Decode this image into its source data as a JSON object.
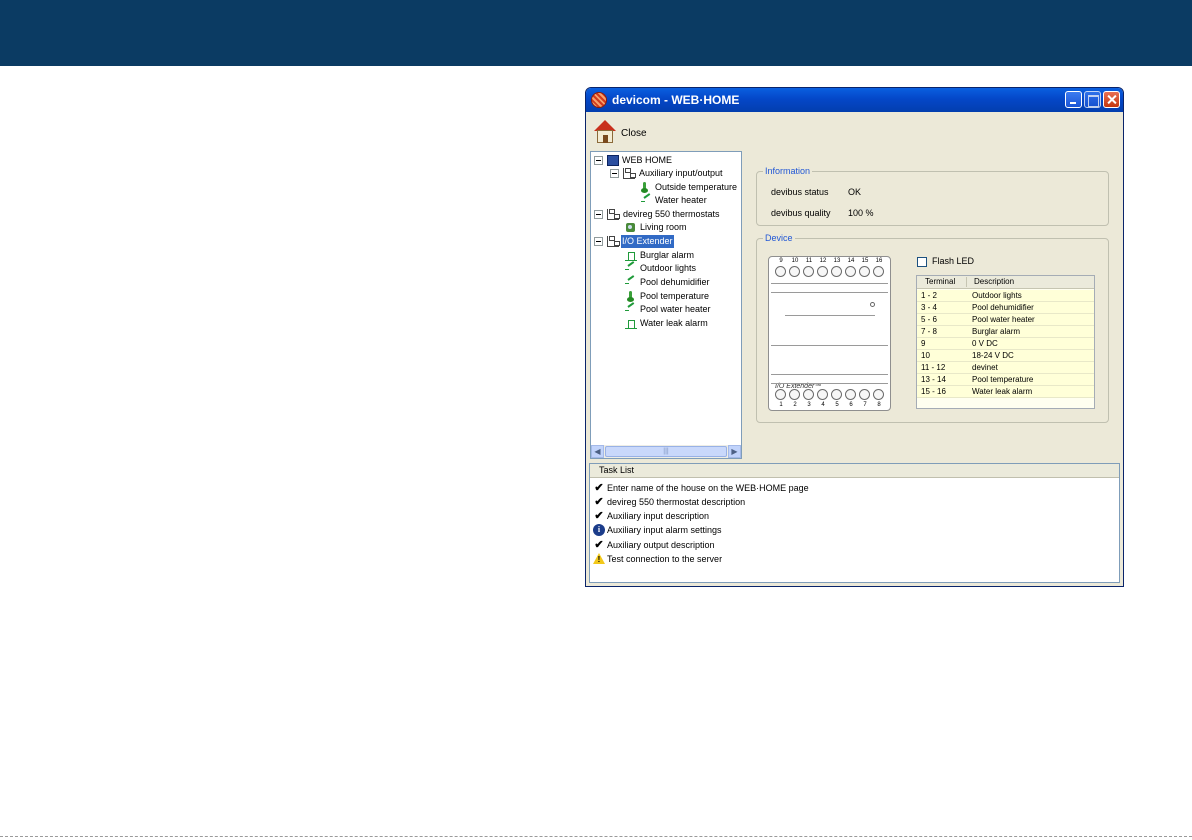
{
  "window": {
    "title": "devicom - WEB·HOME"
  },
  "toolbar": {
    "close_label": "Close"
  },
  "tree": {
    "root": "WEB HOME",
    "aux_group": "Auxiliary input/output",
    "aux_items": [
      "Outside temperature",
      "Water heater"
    ],
    "thermostats_group": "devireg 550 thermostats",
    "thermostat_items": [
      "Living room"
    ],
    "extender_group": "I/O Extender",
    "extender_items": [
      "Burglar alarm",
      "Outdoor lights",
      "Pool dehumidifier",
      "Pool temperature",
      "Pool water heater",
      "Water leak alarm"
    ]
  },
  "information": {
    "legend": "Information",
    "status_label": "devibus status",
    "status_value": "OK",
    "quality_label": "devibus quality",
    "quality_value": "100 %"
  },
  "device": {
    "legend": "Device",
    "flash_led_label": "Flash LED",
    "flash_led_checked": false,
    "brand_label": "I/O Extender™",
    "top_pins": [
      "9",
      "10",
      "11",
      "12",
      "13",
      "14",
      "15",
      "16"
    ],
    "bottom_pins": [
      "1",
      "2",
      "3",
      "4",
      "5",
      "6",
      "7",
      "8"
    ],
    "table_headers": [
      "Terminal",
      "Description"
    ],
    "terminals": [
      {
        "terminal": "1 - 2",
        "description": "Outdoor lights"
      },
      {
        "terminal": "3 - 4",
        "description": "Pool dehumidifier"
      },
      {
        "terminal": "5 - 6",
        "description": "Pool water heater"
      },
      {
        "terminal": "7 - 8",
        "description": "Burglar alarm"
      },
      {
        "terminal": "9",
        "description": "0 V DC"
      },
      {
        "terminal": "10",
        "description": "18-24 V DC"
      },
      {
        "terminal": "11 - 12",
        "description": "devinet"
      },
      {
        "terminal": "13 - 14",
        "description": "Pool temperature"
      },
      {
        "terminal": "15 - 16",
        "description": "Water leak alarm"
      }
    ]
  },
  "tasks": {
    "header": "Task List",
    "items": [
      {
        "status": "check",
        "text": "Enter name of the house on the WEB·HOME page"
      },
      {
        "status": "check",
        "text": "devireg 550 thermostat description"
      },
      {
        "status": "check",
        "text": "Auxiliary input description"
      },
      {
        "status": "info",
        "text": "Auxiliary input alarm settings"
      },
      {
        "status": "check",
        "text": "Auxiliary output description"
      },
      {
        "status": "warning",
        "text": "Test connection to the server"
      }
    ]
  },
  "colors": {
    "header_band": "#0b3b63",
    "selection": "#316ac5",
    "legend_text": "#2157d5",
    "table_row": "#ffffd8"
  }
}
